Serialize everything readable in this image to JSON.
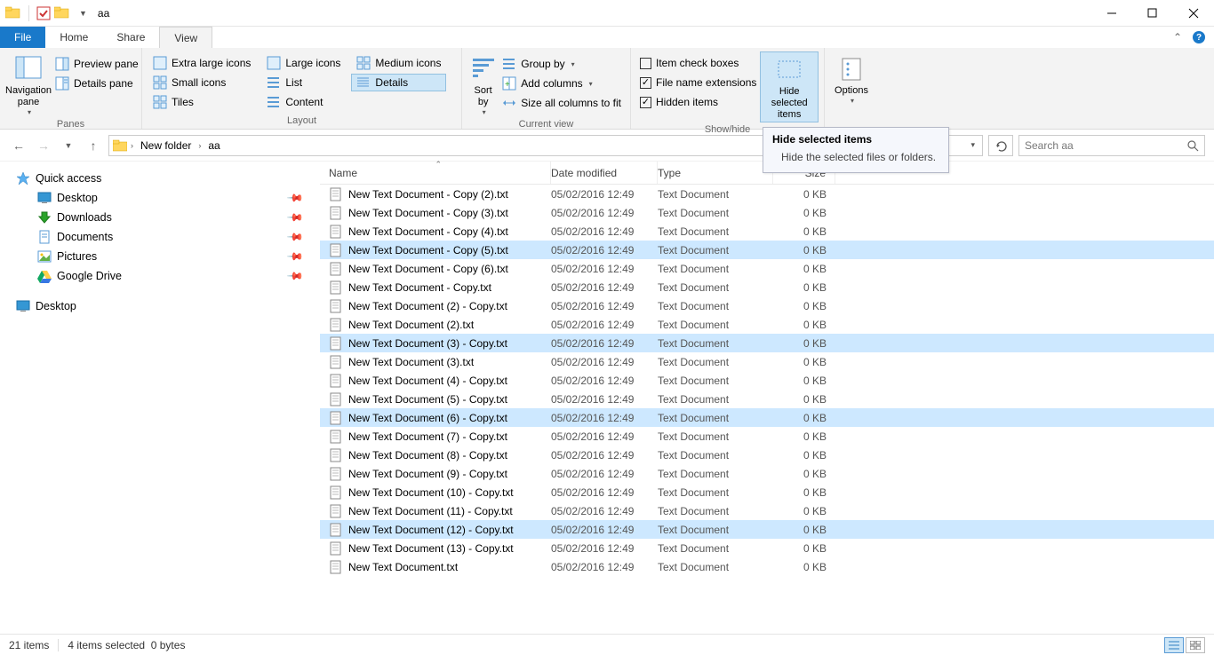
{
  "title": "aa",
  "tabs": {
    "file": "File",
    "home": "Home",
    "share": "Share",
    "view": "View"
  },
  "ribbon": {
    "panes": {
      "nav": "Navigation\npane",
      "nav_drop": "▾",
      "preview": "Preview pane",
      "details": "Details pane",
      "group": "Panes"
    },
    "layout": {
      "xl": "Extra large icons",
      "l": "Large icons",
      "m": "Medium icons",
      "s": "Small icons",
      "list": "List",
      "det": "Details",
      "tiles": "Tiles",
      "content": "Content",
      "group": "Layout"
    },
    "curview": {
      "sort": "Sort\nby",
      "sort_drop": "▾",
      "groupby": "Group by",
      "addcols": "Add columns",
      "sizeall": "Size all columns to fit",
      "group": "Current view"
    },
    "showhide": {
      "itemcheck": "Item check boxes",
      "fileext": "File name extensions",
      "hidden": "Hidden items",
      "hidebtn": "Hide selected\nitems",
      "group": "Show/hide"
    },
    "options": "Options"
  },
  "addressbar": {
    "seg1": "New folder",
    "seg2": "aa",
    "dropdown": "▾"
  },
  "search_placeholder": "Search aa",
  "tooltip": {
    "title": "Hide selected items",
    "body": "Hide the selected files or folders."
  },
  "tree": {
    "qa": "Quick access",
    "desktop": "Desktop",
    "downloads": "Downloads",
    "documents": "Documents",
    "pictures": "Pictures",
    "gdrive": "Google Drive",
    "desktop2": "Desktop"
  },
  "headers": {
    "name": "Name",
    "date": "Date modified",
    "type": "Type",
    "size": "Size"
  },
  "files": [
    {
      "n": "New Text Document - Copy (2).txt",
      "d": "05/02/2016 12:49",
      "t": "Text Document",
      "s": "0 KB",
      "sel": false
    },
    {
      "n": "New Text Document - Copy (3).txt",
      "d": "05/02/2016 12:49",
      "t": "Text Document",
      "s": "0 KB",
      "sel": false
    },
    {
      "n": "New Text Document - Copy (4).txt",
      "d": "05/02/2016 12:49",
      "t": "Text Document",
      "s": "0 KB",
      "sel": false
    },
    {
      "n": "New Text Document - Copy (5).txt",
      "d": "05/02/2016 12:49",
      "t": "Text Document",
      "s": "0 KB",
      "sel": true
    },
    {
      "n": "New Text Document - Copy (6).txt",
      "d": "05/02/2016 12:49",
      "t": "Text Document",
      "s": "0 KB",
      "sel": false
    },
    {
      "n": "New Text Document - Copy.txt",
      "d": "05/02/2016 12:49",
      "t": "Text Document",
      "s": "0 KB",
      "sel": false
    },
    {
      "n": "New Text Document (2) - Copy.txt",
      "d": "05/02/2016 12:49",
      "t": "Text Document",
      "s": "0 KB",
      "sel": false
    },
    {
      "n": "New Text Document (2).txt",
      "d": "05/02/2016 12:49",
      "t": "Text Document",
      "s": "0 KB",
      "sel": false
    },
    {
      "n": "New Text Document (3) - Copy.txt",
      "d": "05/02/2016 12:49",
      "t": "Text Document",
      "s": "0 KB",
      "sel": true
    },
    {
      "n": "New Text Document (3).txt",
      "d": "05/02/2016 12:49",
      "t": "Text Document",
      "s": "0 KB",
      "sel": false
    },
    {
      "n": "New Text Document (4) - Copy.txt",
      "d": "05/02/2016 12:49",
      "t": "Text Document",
      "s": "0 KB",
      "sel": false
    },
    {
      "n": "New Text Document (5) - Copy.txt",
      "d": "05/02/2016 12:49",
      "t": "Text Document",
      "s": "0 KB",
      "sel": false
    },
    {
      "n": "New Text Document (6) - Copy.txt",
      "d": "05/02/2016 12:49",
      "t": "Text Document",
      "s": "0 KB",
      "sel": true
    },
    {
      "n": "New Text Document (7) - Copy.txt",
      "d": "05/02/2016 12:49",
      "t": "Text Document",
      "s": "0 KB",
      "sel": false
    },
    {
      "n": "New Text Document (8) - Copy.txt",
      "d": "05/02/2016 12:49",
      "t": "Text Document",
      "s": "0 KB",
      "sel": false
    },
    {
      "n": "New Text Document (9) - Copy.txt",
      "d": "05/02/2016 12:49",
      "t": "Text Document",
      "s": "0 KB",
      "sel": false
    },
    {
      "n": "New Text Document (10) - Copy.txt",
      "d": "05/02/2016 12:49",
      "t": "Text Document",
      "s": "0 KB",
      "sel": false
    },
    {
      "n": "New Text Document (11) - Copy.txt",
      "d": "05/02/2016 12:49",
      "t": "Text Document",
      "s": "0 KB",
      "sel": false
    },
    {
      "n": "New Text Document (12) - Copy.txt",
      "d": "05/02/2016 12:49",
      "t": "Text Document",
      "s": "0 KB",
      "sel": true
    },
    {
      "n": "New Text Document (13) - Copy.txt",
      "d": "05/02/2016 12:49",
      "t": "Text Document",
      "s": "0 KB",
      "sel": false
    },
    {
      "n": "New Text Document.txt",
      "d": "05/02/2016 12:49",
      "t": "Text Document",
      "s": "0 KB",
      "sel": false
    }
  ],
  "status": {
    "count": "21 items",
    "sel": "4 items selected",
    "size": "0 bytes"
  }
}
